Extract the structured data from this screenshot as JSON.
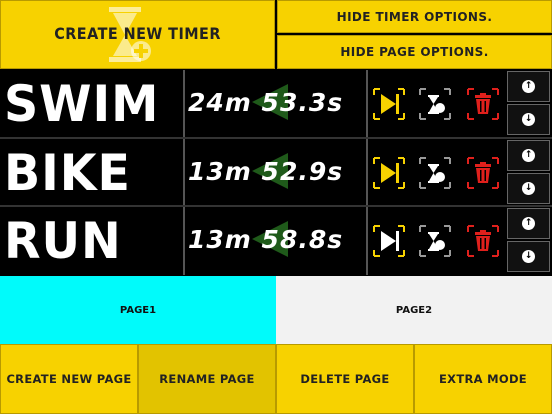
{
  "header": {
    "create_timer_label": "CREATE NEW TIMER",
    "hide_timer_label": "HIDE TIMER OPTIONS.",
    "hide_page_label": "HIDE PAGE OPTIONS."
  },
  "timers": [
    {
      "name": "SWIM",
      "time": "24m 53.3s",
      "play_color": "#f7d200",
      "playing": true
    },
    {
      "name": "BIKE",
      "time": "13m 52.9s",
      "play_color": "#f7d200",
      "playing": true
    },
    {
      "name": "RUN",
      "time": "13m 58.8s",
      "play_color": "#ffffff",
      "playing": false
    }
  ],
  "pages": {
    "page1_label": "PAGE1",
    "page2_label": "PAGE2",
    "active": "PAGE1"
  },
  "bottom": {
    "create_page_label": "CREATE NEW PAGE",
    "rename_page_label": "RENAME PAGE",
    "delete_page_label": "DELETE PAGE",
    "extra_mode_label": "EXTRA MODE"
  },
  "colors": {
    "accent_yellow": "#f7d200",
    "active_page": "#00fbfb",
    "inactive_page": "#f2f2f2",
    "delete_red": "#e0201c",
    "play_bg_green": "#1f5a1a"
  },
  "icons": {
    "create_timer": "hourglass-plus-icon",
    "play": "play-skip-icon",
    "reset": "hourglass-reset-icon",
    "delete": "trash-icon",
    "move_up": "arrow-up-icon",
    "move_down": "arrow-down-icon"
  }
}
